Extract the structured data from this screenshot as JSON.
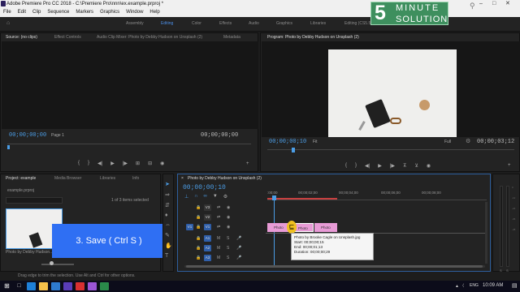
{
  "window": {
    "title": "Adobe Premiere Pro CC 2018 - C:\\Premiere Pro\\nnn\\ex.example.prproj *"
  },
  "menu": [
    "File",
    "Edit",
    "Clip",
    "Sequence",
    "Markers",
    "Graphics",
    "Window",
    "Help"
  ],
  "workspaces": [
    "Assembly",
    "Editing",
    "Color",
    "Effects",
    "Audio",
    "Graphics",
    "Libraries",
    "Editing (CS5.5)"
  ],
  "logo": {
    "digit": "5",
    "line1": "MINUTE",
    "line2": "SOLUTION"
  },
  "source_panel": {
    "tabs": [
      "Source: (no clips)",
      "Effect Controls",
      "Audio Clip Mixer: Photo by Debby Hudson on Unsplash (2)",
      "Metadata"
    ],
    "timecode_left": "00;00;00;00",
    "timecode_right": "00;00;00;00",
    "page": "Page 1"
  },
  "program_panel": {
    "title": "Program: Photo by Debby Hudson on Unsplash (2)",
    "timecode_left": "00;00;00;10",
    "fit": "Fit",
    "quality": "Full",
    "timecode_right": "00;00;03;12"
  },
  "project_panel": {
    "tabs": [
      "Project: example",
      "Media Browser",
      "Libraries",
      "Info"
    ],
    "filename": "example.prproj",
    "selection": "1 of 3 items selected",
    "thumb_label": "Photo by Debby Hudson..."
  },
  "timeline": {
    "tab": "Photo by Debby Hudson on Unsplash (2)",
    "timecode": "00;00;00;10",
    "ruler": [
      ":00;00",
      "00;00;02;00",
      "00;00;04;00",
      "00;00;06;00",
      "00;00;08;00"
    ],
    "video_tracks": [
      "V3",
      "V2",
      "V1"
    ],
    "audio_tracks": [
      "A1",
      "A2",
      "A3"
    ],
    "clips": [
      "Photo",
      "Photo",
      "Photo"
    ]
  },
  "tooltip": {
    "name": "Photo by Brooke Cagle on Unsplash.jpg",
    "start": "Start: 00;00;00;15",
    "end": "End: 00;00;01;13",
    "duration": "Duration: 00;00;00;29"
  },
  "callout": {
    "text": "3. Save ( Ctrl S )"
  },
  "status": {
    "text": "Drag edge to trim the selection. Use Alt and Ctrl for other options."
  },
  "taskbar": {
    "time": "10:09 AM",
    "lang": "ENG"
  },
  "colors": {
    "accent_blue": "#4b9de6",
    "clip_pink": "#e89bd6",
    "callout_blue": "#2f6ff3",
    "track_blue": "#2f5ea8",
    "logo_green": "#3e8f5e"
  }
}
